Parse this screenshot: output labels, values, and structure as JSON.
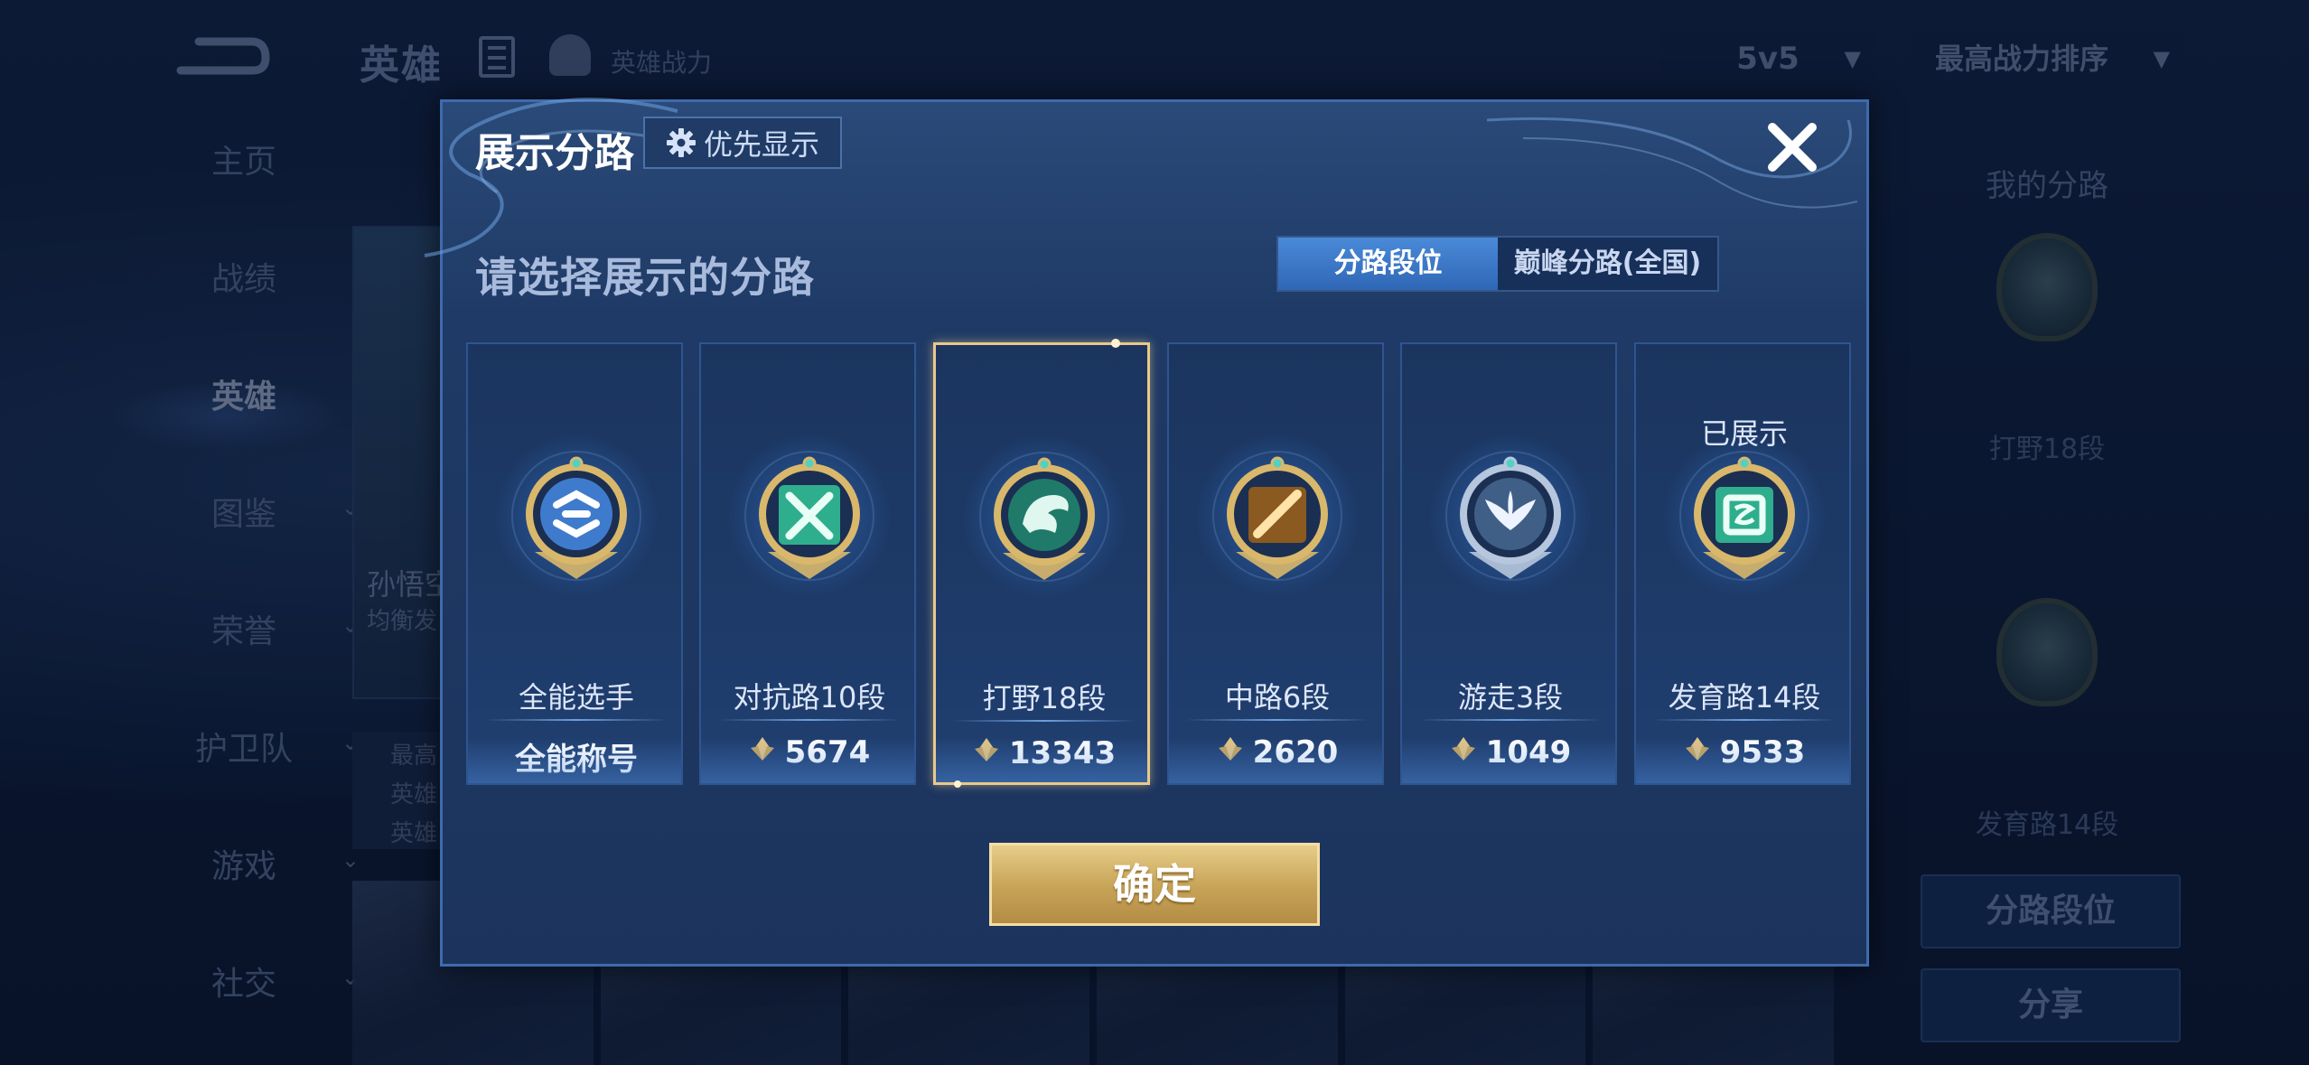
{
  "background": {
    "top_title": "英雄",
    "top_power_label": "英雄战力",
    "mode_select": "5v5",
    "sort_select": "最高战力排序",
    "nav": [
      {
        "label": "主页",
        "has_arrow": false
      },
      {
        "label": "战绩",
        "has_arrow": false
      },
      {
        "label": "英雄",
        "has_arrow": false,
        "active": true
      },
      {
        "label": "图鉴",
        "has_arrow": true
      },
      {
        "label": "荣誉",
        "has_arrow": true
      },
      {
        "label": "护卫队",
        "has_arrow": true
      },
      {
        "label": "游戏",
        "has_arrow": true
      },
      {
        "label": "社交",
        "has_arrow": true
      }
    ],
    "hero_card": {
      "name": "孙悟空",
      "subtitle": "均衡发"
    },
    "stat_lines": [
      "最高",
      "英雄",
      "英雄"
    ],
    "right_panel": {
      "title": "我的分路",
      "badge1_label": "打野18段",
      "badge2_label": "发育路14段",
      "lane_rank_button": "分路段位",
      "share_button": "分享"
    }
  },
  "modal": {
    "title": "展示分路",
    "priority_button": "优先显示",
    "prompt": "请选择展示的分路",
    "tabs": [
      {
        "label": "分路段位",
        "active": true
      },
      {
        "label": "巅峰分路(全国)",
        "active": false
      }
    ],
    "cards": [
      {
        "lane": "全能选手",
        "score": "全能称号",
        "shows_power_icon": false,
        "shown_label": "",
        "selected": false,
        "badge": "allround-badge-icon"
      },
      {
        "lane": "对抗路10段",
        "score": "5674",
        "shows_power_icon": true,
        "shown_label": "",
        "selected": false,
        "badge": "clash-lane-badge-icon"
      },
      {
        "lane": "打野18段",
        "score": "13343",
        "shows_power_icon": true,
        "shown_label": "",
        "selected": true,
        "badge": "jungle-badge-icon"
      },
      {
        "lane": "中路6段",
        "score": "2620",
        "shows_power_icon": true,
        "shown_label": "",
        "selected": false,
        "badge": "mid-lane-badge-icon"
      },
      {
        "lane": "游走3段",
        "score": "1049",
        "shows_power_icon": true,
        "shown_label": "",
        "selected": false,
        "badge": "roam-badge-icon"
      },
      {
        "lane": "发育路14段",
        "score": "9533",
        "shows_power_icon": true,
        "shown_label": "已展示",
        "selected": false,
        "badge": "farm-lane-badge-icon"
      }
    ],
    "confirm_button": "确定"
  },
  "colors": {
    "gold": "#d9b86c",
    "accent_blue": "#3f7bcc",
    "jade": "#2fae8e",
    "silver": "#b6c6dc"
  }
}
